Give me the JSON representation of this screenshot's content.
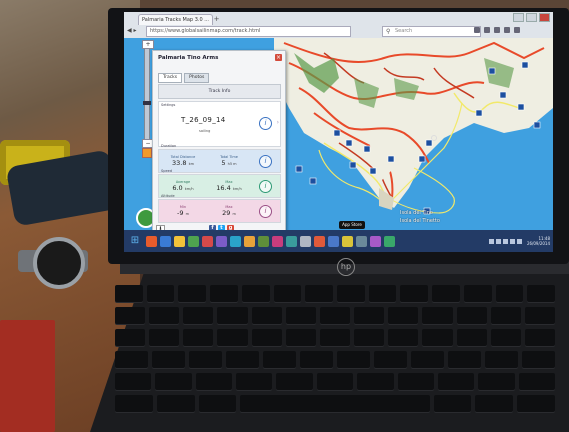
{
  "browser": {
    "tab_title": "Palmaria Tracks Map 3.0 ...",
    "url": "https://www.globalsailinmap.com/track.html",
    "search_placeholder": "Search"
  },
  "panel": {
    "title": "Palmaria Tino Arms",
    "tabs": [
      "Tracks",
      "Photos"
    ],
    "track_info_label": "Track Info",
    "settings_label": "Settings",
    "track_name": "T_26_09_14",
    "track_sub": "sailing",
    "duration": {
      "label": "Duration",
      "total_distance_label": "Total Distance",
      "total_distance_value": "33.8",
      "total_distance_unit": "km",
      "total_time_label": "Total Time",
      "total_time_value": "5",
      "total_time_unit": "h5 m"
    },
    "speed": {
      "label": "Speed",
      "average_label": "Average",
      "average_value": "6.0",
      "average_unit": "km/h",
      "max_label": "Max",
      "max_value": "16.4",
      "max_unit": "km/h"
    },
    "altitude": {
      "label": "Altitude",
      "min_label": "Min",
      "min_value": "-9",
      "min_unit": "m",
      "max_label": "Max",
      "max_value": "29",
      "max_unit": "m"
    }
  },
  "map": {
    "labels": [
      "Isola del Tino",
      "Isola del Tinetto"
    ],
    "app_store_label": "App Store"
  },
  "taskbar": {
    "time": "11:48",
    "date": "26/09/2014"
  },
  "laptop": {
    "logo": "hp"
  },
  "colors": {
    "sea": "#3fa0e0",
    "land": "#f0efe6",
    "tracks": "#e84a2a",
    "route": "#f2e96a"
  }
}
